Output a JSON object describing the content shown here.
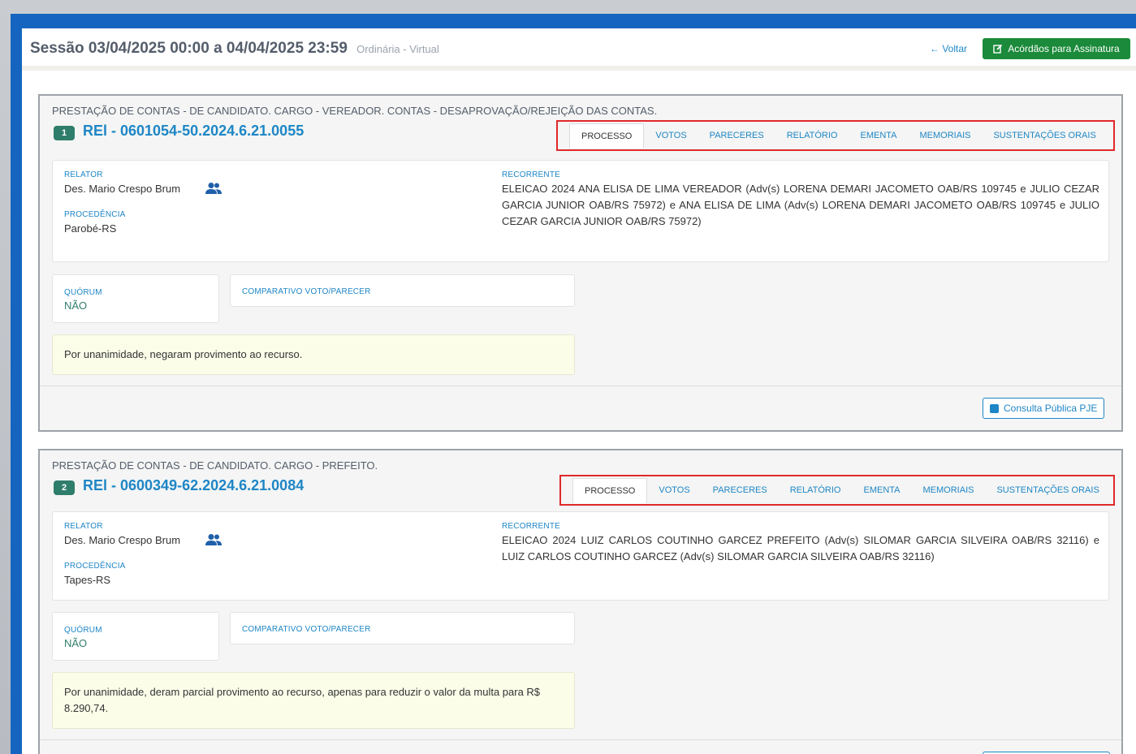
{
  "header": {
    "title": "Sessão 03/04/2025 00:00 a 04/04/2025 23:59",
    "subtitle": "Ordinária - Virtual",
    "back_label": "← Voltar",
    "acordaos_label": "Acórdãos para Assinatura"
  },
  "processes": [
    {
      "classification": "PRESTAÇÃO DE CONTAS - DE CANDIDATO. CARGO - VEREADOR. CONTAS - DESAPROVAÇÃO/REJEIÇÃO DAS CONTAS.",
      "index": "1",
      "number": "REl - 0601054-50.2024.6.21.0055",
      "tabs": [
        "PROCESSO",
        "VOTOS",
        "PARECERES",
        "RELATÓRIO",
        "EMENTA",
        "MEMORIAIS",
        "SUSTENTAÇÕES ORAIS"
      ],
      "relator_label": "RELATOR",
      "relator": "Des. Mario Crespo Brum",
      "procedencia_label": "PROCEDÊNCIA",
      "procedencia": "Parobé-RS",
      "recorrente_label": "RECORRENTE",
      "recorrente": "ELEICAO 2024 ANA ELISA DE LIMA VEREADOR (Adv(s) LORENA DEMARI JACOMETO OAB/RS 109745 e JULIO CEZAR GARCIA JUNIOR OAB/RS 75972) e ANA ELISA DE LIMA (Adv(s) LORENA DEMARI JACOMETO OAB/RS 109745 e JULIO CEZAR GARCIA JUNIOR OAB/RS 75972)",
      "quorum_label": "QUÓRUM",
      "quorum": "NÃO",
      "comparativo_label": "COMPARATIVO VOTO/PARECER",
      "result": "Por unanimidade, negaram provimento ao recurso.",
      "consulta_label": "Consulta Pública PJE"
    },
    {
      "classification": "PRESTAÇÃO DE CONTAS - DE CANDIDATO. CARGO - PREFEITO.",
      "index": "2",
      "number": "REl - 0600349-62.2024.6.21.0084",
      "tabs": [
        "PROCESSO",
        "VOTOS",
        "PARECERES",
        "RELATÓRIO",
        "EMENTA",
        "MEMORIAIS",
        "SUSTENTAÇÕES ORAIS"
      ],
      "relator_label": "RELATOR",
      "relator": "Des. Mario Crespo Brum",
      "procedencia_label": "PROCEDÊNCIA",
      "procedencia": "Tapes-RS",
      "recorrente_label": "RECORRENTE",
      "recorrente": "ELEICAO 2024 LUIZ CARLOS COUTINHO GARCEZ PREFEITO (Adv(s) SILOMAR GARCIA SILVEIRA OAB/RS 32116) e LUIZ CARLOS COUTINHO GARCEZ (Adv(s) SILOMAR GARCIA SILVEIRA OAB/RS 32116)",
      "quorum_label": "QUÓRUM",
      "quorum": "NÃO",
      "comparativo_label": "COMPARATIVO VOTO/PARECER",
      "result": "Por unanimidade, deram parcial provimento ao recurso, apenas para reduzir o valor da multa para R$ 8.290,74."
    }
  ],
  "colors": {
    "frame": "#1565c0",
    "accent_blue": "#1e86c6",
    "green_button": "#1b8a3a",
    "highlight_red": "#e0282a",
    "badge_teal": "#2f7d6b"
  },
  "icons": {
    "back": "arrow-left-icon",
    "acordaos": "edit-icon",
    "relator": "users-icon",
    "consulta": "external-link-icon"
  }
}
